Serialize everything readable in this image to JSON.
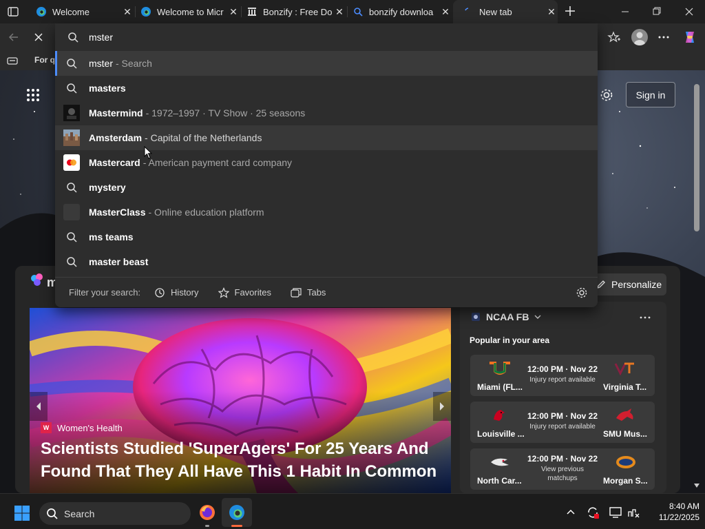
{
  "tabs": [
    {
      "title": "Welcome",
      "icon": "edge-icon"
    },
    {
      "title": "Welcome to Micr",
      "icon": "edge-icon"
    },
    {
      "title": "Bonzify : Free Do",
      "icon": "archive-icon"
    },
    {
      "title": "bonzify downloa",
      "icon": "search-icon"
    },
    {
      "title": "New tab",
      "icon": "new-tab-spinner-icon"
    }
  ],
  "bookmarks": {
    "first_label": "For q"
  },
  "omnibox": {
    "query": "mster",
    "suggestions": [
      {
        "main": "mster",
        "sub": "- Search",
        "icon": "search-icon"
      },
      {
        "main": "masters",
        "sub": "",
        "icon": "search-icon"
      },
      {
        "main": "Mastermind",
        "sub": "- 1972–1997 · TV Show · 25 seasons",
        "icon": "thumbnail"
      },
      {
        "main": "Amsterdam",
        "sub": "- Capital of the Netherlands",
        "icon": "thumbnail"
      },
      {
        "main": "Mastercard",
        "sub": "- American payment card company",
        "icon": "mastercard-logo"
      },
      {
        "main": "mystery",
        "sub": "",
        "icon": "search-icon"
      },
      {
        "main": "MasterClass",
        "sub": "- Online education platform",
        "icon": "thumbnail"
      },
      {
        "main": "ms teams",
        "sub": "",
        "icon": "search-icon"
      },
      {
        "main": "master beast",
        "sub": "",
        "icon": "search-icon"
      }
    ],
    "filter_label": "Filter your search:",
    "filters": [
      "History",
      "Favorites",
      "Tabs"
    ]
  },
  "header": {
    "sign_in": "Sign in",
    "personalize": "Personalize"
  },
  "hero": {
    "source": "Women's Health",
    "headline": "Scientists Studied 'SuperAgers' For 25 Years And Found That They All Have This 1 Habit In Common"
  },
  "sports": {
    "league": "NCAA FB",
    "subtitle": "Popular in your area",
    "games": [
      {
        "time": "12:00 PM · Nov 22",
        "note": "Injury report available",
        "home": "Miami (FL...",
        "away": "Virginia T..."
      },
      {
        "time": "12:00 PM · Nov 22",
        "note": "Injury report available",
        "home": "Louisville ...",
        "away": "SMU Mus..."
      },
      {
        "time": "12:00 PM · Nov 22",
        "note": "View previous matchups",
        "home": "North Car...",
        "away": "Morgan S..."
      }
    ]
  },
  "taskbar": {
    "search_label": "Search",
    "time": "8:40 AM",
    "date": "11/22/2025"
  },
  "colors": {
    "accent": "#4c8dff",
    "omnibox_bg": "#2d2d2d",
    "tab_bg": "#202020"
  }
}
